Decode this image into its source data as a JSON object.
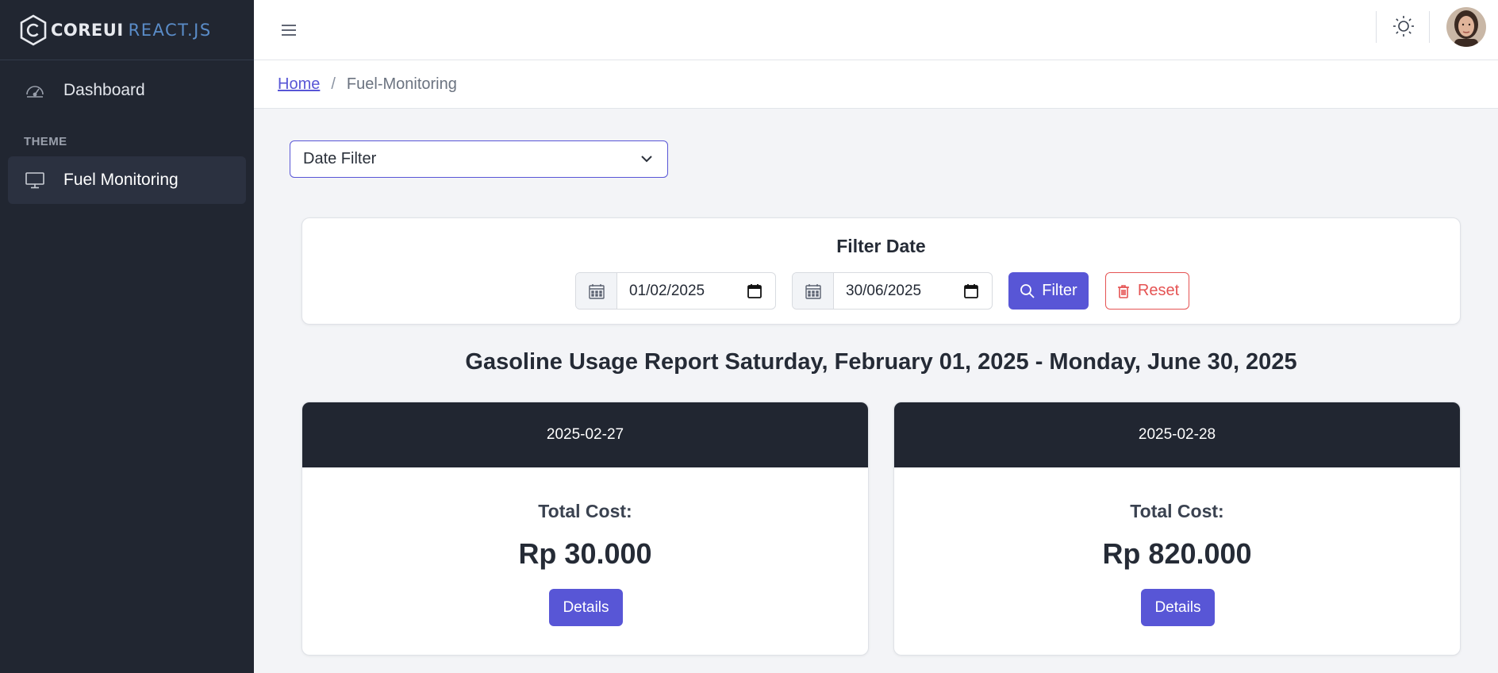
{
  "brand": {
    "core": "COREUI",
    "react": "REACT.JS"
  },
  "sidebar": {
    "items": [
      {
        "label": "Dashboard",
        "icon": "speedometer-icon"
      },
      {
        "label": "Fuel Monitoring",
        "icon": "monitor-icon",
        "active": true
      }
    ],
    "section_title": "THEME"
  },
  "header": {
    "toggler_icon": "hamburger-icon",
    "theme_icon": "sun-icon",
    "avatar": "user-avatar"
  },
  "breadcrumb": {
    "home": "Home",
    "separator": "/",
    "current": "Fuel-Monitoring"
  },
  "date_filter_select": {
    "selected": "Date Filter"
  },
  "filter_card": {
    "title": "Filter Date",
    "start_date": "01/02/2025",
    "end_date": "30/06/2025",
    "filter_label": "Filter",
    "reset_label": "Reset"
  },
  "report": {
    "title": "Gasoline Usage Report Saturday, February 01, 2025 - Monday, June 30, 2025",
    "cards": [
      {
        "date": "2025-02-27",
        "label": "Total Cost:",
        "value": "Rp 30.000",
        "button": "Details"
      },
      {
        "date": "2025-02-28",
        "label": "Total Cost:",
        "value": "Rp 820.000",
        "button": "Details"
      }
    ]
  },
  "colors": {
    "primary": "#5856d6",
    "danger": "#e55353",
    "sidebar": "#212631"
  }
}
